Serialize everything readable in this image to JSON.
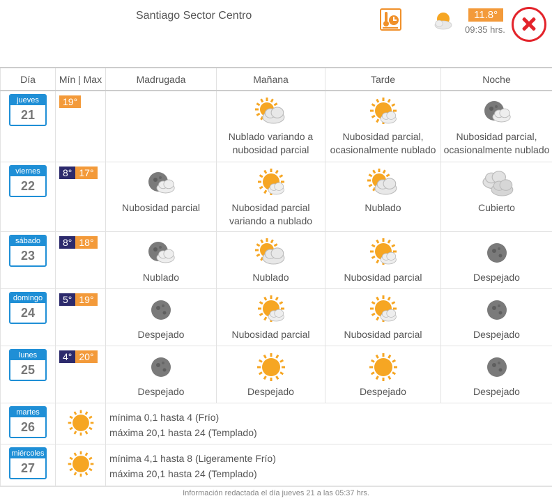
{
  "header": {
    "location": "Santiago Sector Centro",
    "current_temp": "11.8°",
    "current_time": "09:35 hrs.",
    "current_icon": "sun-cloud-icon",
    "tool_icon": "thermometer-clock-icon",
    "close_icon": "close-icon"
  },
  "columns": {
    "day": "Día",
    "minmax": "Mín | Max",
    "madrugada": "Madrugada",
    "manana": "Mañana",
    "tarde": "Tarde",
    "noche": "Noche"
  },
  "days": [
    {
      "name": "jueves",
      "date": "21",
      "min": "",
      "max": "19°",
      "periods": [
        {
          "icon": "",
          "label": ""
        },
        {
          "icon": "sun-cloud",
          "label": "Nublado variando a nubosidad parcial"
        },
        {
          "icon": "sun-partial",
          "label": "Nubosidad parcial, ocasionalmente nublado"
        },
        {
          "icon": "moon-cloud",
          "label": "Nubosidad parcial, ocasionalmente nublado"
        }
      ]
    },
    {
      "name": "viernes",
      "date": "22",
      "min": "8°",
      "max": "17°",
      "periods": [
        {
          "icon": "moon-cloud",
          "label": "Nubosidad parcial"
        },
        {
          "icon": "sun-partial",
          "label": "Nubosidad parcial variando a nublado"
        },
        {
          "icon": "sun-cloud",
          "label": "Nublado"
        },
        {
          "icon": "clouds",
          "label": "Cubierto"
        }
      ]
    },
    {
      "name": "sábado",
      "date": "23",
      "min": "8°",
      "max": "18°",
      "periods": [
        {
          "icon": "moon-cloud",
          "label": "Nublado"
        },
        {
          "icon": "sun-cloud",
          "label": "Nublado"
        },
        {
          "icon": "sun-partial",
          "label": "Nubosidad parcial"
        },
        {
          "icon": "moon",
          "label": "Despejado"
        }
      ]
    },
    {
      "name": "domingo",
      "date": "24",
      "min": "5°",
      "max": "19°",
      "periods": [
        {
          "icon": "moon",
          "label": "Despejado"
        },
        {
          "icon": "sun-partial",
          "label": "Nubosidad parcial"
        },
        {
          "icon": "sun-partial",
          "label": "Nubosidad parcial"
        },
        {
          "icon": "moon",
          "label": "Despejado"
        }
      ]
    },
    {
      "name": "lunes",
      "date": "25",
      "min": "4°",
      "max": "20°",
      "periods": [
        {
          "icon": "moon",
          "label": "Despejado"
        },
        {
          "icon": "sun",
          "label": "Despejado"
        },
        {
          "icon": "sun",
          "label": "Despejado"
        },
        {
          "icon": "moon",
          "label": "Despejado"
        }
      ]
    }
  ],
  "extended": [
    {
      "name": "martes",
      "date": "26",
      "icon": "sun",
      "min_text": "mínima 0,1 hasta 4 (Frío)",
      "max_text": "máxima 20,1 hasta 24 (Templado)"
    },
    {
      "name": "miércoles",
      "date": "27",
      "icon": "sun",
      "min_text": "mínima 4,1 hasta 8 (Ligeramente Frío)",
      "max_text": "máxima 20,1 hasta 24 (Templado)"
    }
  ],
  "footer": "Información redactada el día jueves 21 a las 05:37 hrs.",
  "colors": {
    "accent_orange": "#f39a3a",
    "day_blue": "#1f8fd6",
    "min_navy": "#2c2a6c",
    "close_red": "#e3242b"
  }
}
